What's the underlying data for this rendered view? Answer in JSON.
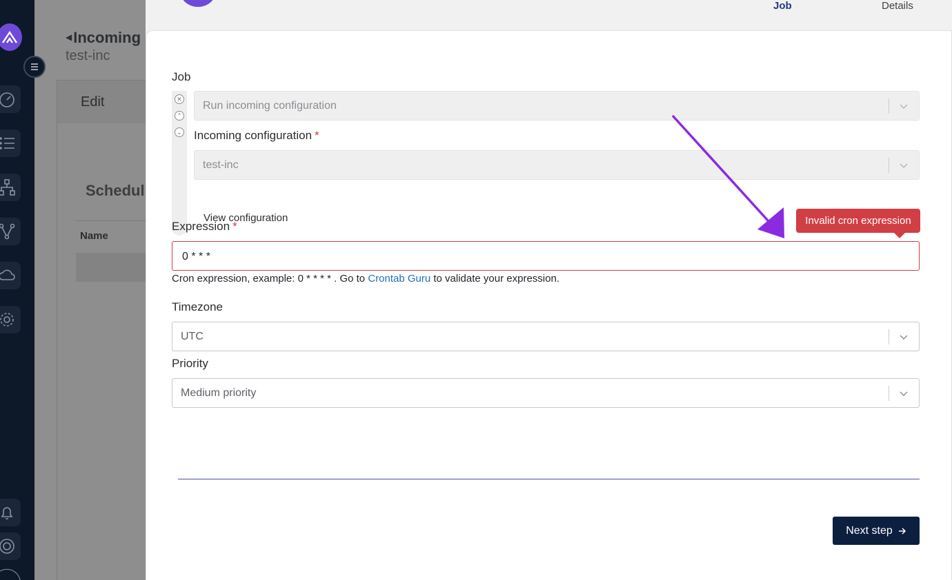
{
  "background": {
    "page_title": "Incoming",
    "page_subtitle": "test-inc",
    "card_header": "Edit",
    "section_title": "Schedul",
    "table_column": "Name"
  },
  "wizard": {
    "steps": [
      "Job",
      "Details"
    ],
    "active_step": "Job"
  },
  "form": {
    "job": {
      "label": "Job",
      "value": "Run incoming configuration"
    },
    "incoming_configuration": {
      "label": "Incoming configuration",
      "required_mark": "*",
      "value": "test-inc",
      "view_link": "View configuration"
    },
    "expression": {
      "label": "Expression",
      "required_mark": "*",
      "value": "0 * * *",
      "error": "Invalid cron expression",
      "hint_prefix": "Cron expression, example: 0 * * * * . Go to ",
      "hint_link": "Crontab Guru",
      "hint_suffix": " to validate your expression."
    },
    "timezone": {
      "label": "Timezone",
      "value": "UTC"
    },
    "priority": {
      "label": "Priority",
      "value": "Medium priority"
    }
  },
  "actions": {
    "next_label": "Next step",
    "next_icon": "arrow-right-icon"
  },
  "colors": {
    "error": "#d13f44",
    "primary_button": "#0d1f3f",
    "link": "#1e6fb6",
    "annotation_arrow": "#8a2be2",
    "brand": "#6d4ad8"
  }
}
